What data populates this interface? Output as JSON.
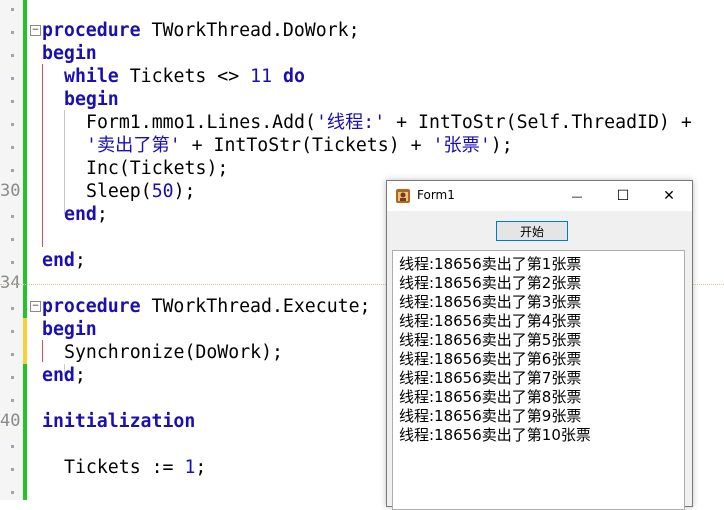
{
  "editor": {
    "gutter_numbers": [
      "30",
      "34",
      "40"
    ],
    "lines": {
      "l1": {
        "kw": "procedure",
        "rest": " TWorkThread.DoWork;"
      },
      "l2": {
        "kw": "begin"
      },
      "l3": {
        "kw": "while",
        "mid": " Tickets <> ",
        "num": "11",
        "kw2": " do"
      },
      "l4": {
        "kw": "begin"
      },
      "l5": {
        "a": "Form1.mmo1.Lines.Add(",
        "s": "'线程:'",
        "b": " + IntToStr(Self.ThreadID) +"
      },
      "l6": {
        "s": "'卖出了第'",
        "a": " + IntToStr(Tickets) + ",
        "s2": "'张票'",
        "b": ");"
      },
      "l7": {
        "a": "Inc(Tickets);"
      },
      "l8": {
        "a": "Sleep(",
        "num": "50",
        "b": ");"
      },
      "l9": {
        "kw": "end",
        "b": ";"
      },
      "l10": {
        "kw": "end",
        "b": ";"
      },
      "l11": {
        "kw": "procedure",
        "rest": " TWorkThread.Execute;"
      },
      "l12": {
        "kw": "begin"
      },
      "l13": {
        "a": "Synchronize(DoWork);"
      },
      "l14": {
        "kw": "end",
        "b": ";"
      },
      "l15": {
        "kw": "initialization"
      },
      "l16": {
        "a": "Tickets := ",
        "num": "1",
        "b": ";"
      }
    },
    "fold_glyph": "−"
  },
  "form": {
    "title": "Form1",
    "minimize_glyph": "—",
    "maximize_glyph": "☐",
    "close_glyph": "✕",
    "start_button": "开始",
    "memo_lines": [
      "线程:18656卖出了第1张票",
      "线程:18656卖出了第2张票",
      "线程:18656卖出了第3张票",
      "线程:18656卖出了第4张票",
      "线程:18656卖出了第5张票",
      "线程:18656卖出了第6张票",
      "线程:18656卖出了第7张票",
      "线程:18656卖出了第8张票",
      "线程:18656卖出了第9张票",
      "线程:18656卖出了第10张票"
    ]
  },
  "colors": {
    "keyword": "#1a0fb0",
    "change_green": "#26c22a",
    "change_yellow": "#f3d23a",
    "block_red": "#e04b4b",
    "focus_blue": "#0078d7"
  }
}
